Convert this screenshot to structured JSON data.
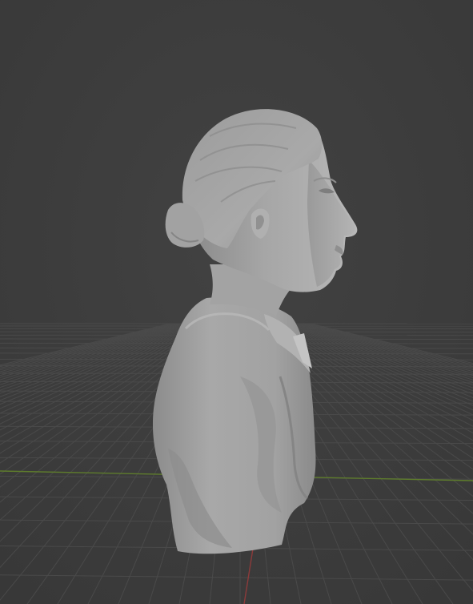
{
  "viewport": {
    "kind": "3d-viewport",
    "background_color": "#3d3d3d",
    "grid_color": "#4a4a4a",
    "x_axis_color": "#8a3a3a",
    "y_axis_color": "#5c7a2a",
    "grid_visible": true
  },
  "model": {
    "name": "sculpted-bust",
    "material": "clay",
    "base_color": "#a8a8a8",
    "view": "side-profile"
  }
}
